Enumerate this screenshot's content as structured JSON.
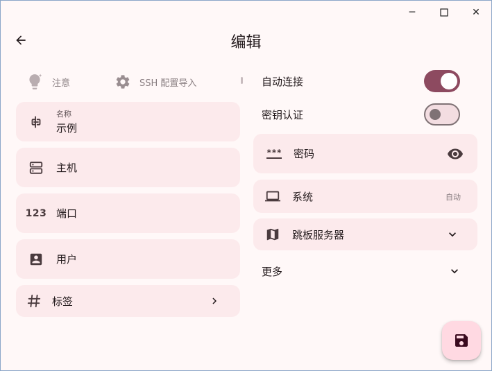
{
  "app": {
    "title": "编辑"
  },
  "window_controls": {
    "minimize": "─",
    "maximize": "☐",
    "close": "✕"
  },
  "tools": {
    "note_label": "注意",
    "ssh_import_label": "SSH 配置导入"
  },
  "fields": {
    "name": {
      "label": "名称",
      "value": "示例"
    },
    "host": {
      "label": "主机"
    },
    "port": {
      "icon_text": "123",
      "label": "端口"
    },
    "user": {
      "label": "用户"
    },
    "tags": {
      "label": "标签"
    }
  },
  "settings": {
    "auto_connect": {
      "label": "自动连接",
      "enabled": true
    },
    "key_auth": {
      "label": "密钥认证",
      "enabled": false
    },
    "password": {
      "icon_text": "***",
      "label": "密码"
    },
    "system": {
      "label": "系统",
      "value": "自动"
    },
    "jump_server": {
      "label": "跳板服务器"
    },
    "more": {
      "label": "更多"
    }
  },
  "icons": {
    "back": "arrow-left-icon",
    "note": "lightbulb-icon",
    "ssh_import": "gear-icon",
    "name": "label-icon",
    "host": "server-icon",
    "user": "account-box-icon",
    "tags": "hash-icon",
    "password": "password-icon",
    "eye": "eye-icon",
    "system": "laptop-icon",
    "jump_server": "map-icon",
    "save": "save-icon"
  },
  "colors": {
    "background": "#fff8f8",
    "card": "#fceaec",
    "accent": "#8d4a60",
    "fab": "#ffd9e2",
    "muted_text": "#8a7f82"
  }
}
